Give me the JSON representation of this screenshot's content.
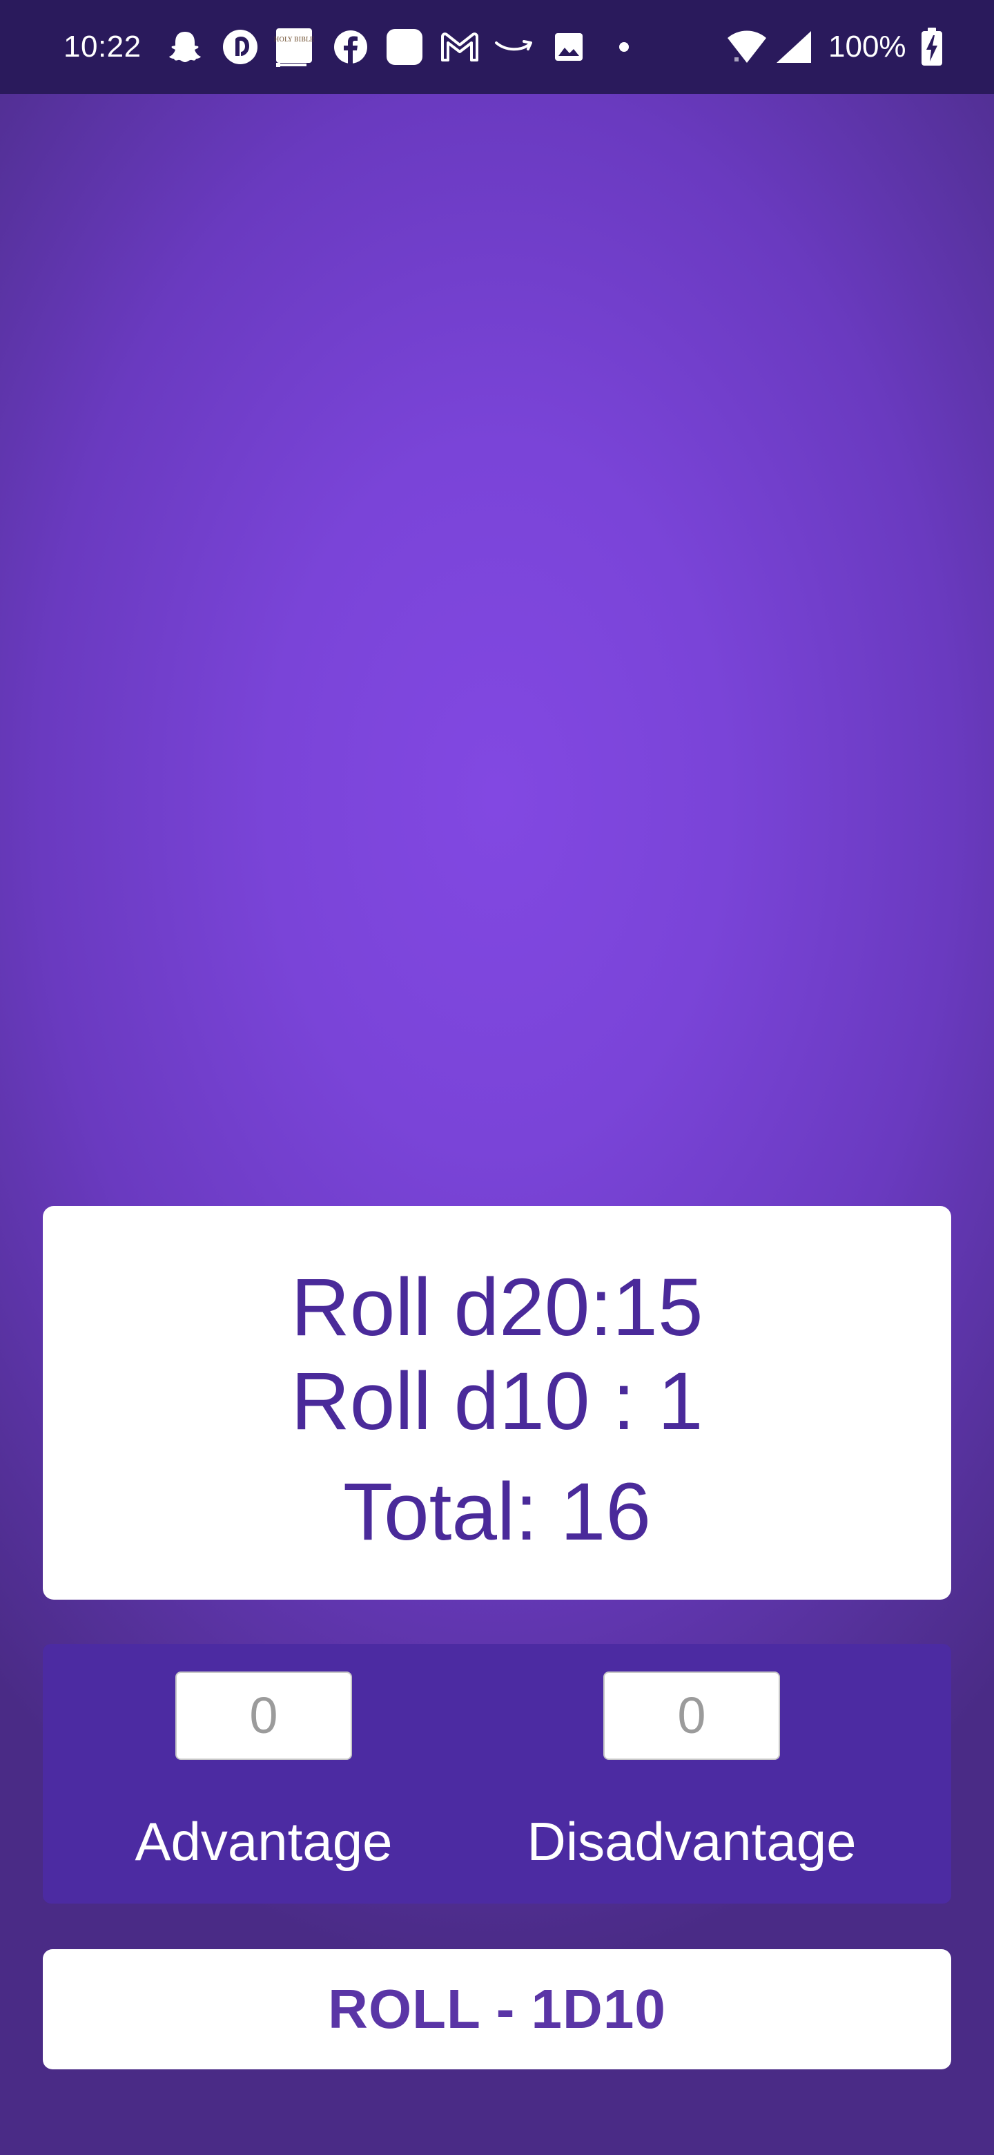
{
  "status_bar": {
    "time": "10:22",
    "battery": "100%",
    "icons": [
      "snapchat-icon",
      "threads-icon",
      "bible-icon",
      "facebook-icon",
      "app-square-icon",
      "gmail-icon",
      "amazon-icon",
      "gallery-icon",
      "dot-icon",
      "wifi-icon",
      "signal-icon",
      "battery-charging-icon"
    ],
    "bible_text": "HOLY BIBLE"
  },
  "colors": {
    "accent": "#4a2a9a",
    "panel": "#4c2ba2",
    "background_center": "#8248e2",
    "background_edge": "#4a2b86",
    "status_bar": "#2a1a5c"
  },
  "result": {
    "line1": "Roll d20:15",
    "line2": "Roll d10 : 1",
    "line3": "Total: 16"
  },
  "modifiers": {
    "advantage_value": "0",
    "advantage_label": "Advantage",
    "disadvantage_value": "0",
    "disadvantage_label": "Disadvantage"
  },
  "roll_button": {
    "label": "ROLL - 1D10"
  }
}
